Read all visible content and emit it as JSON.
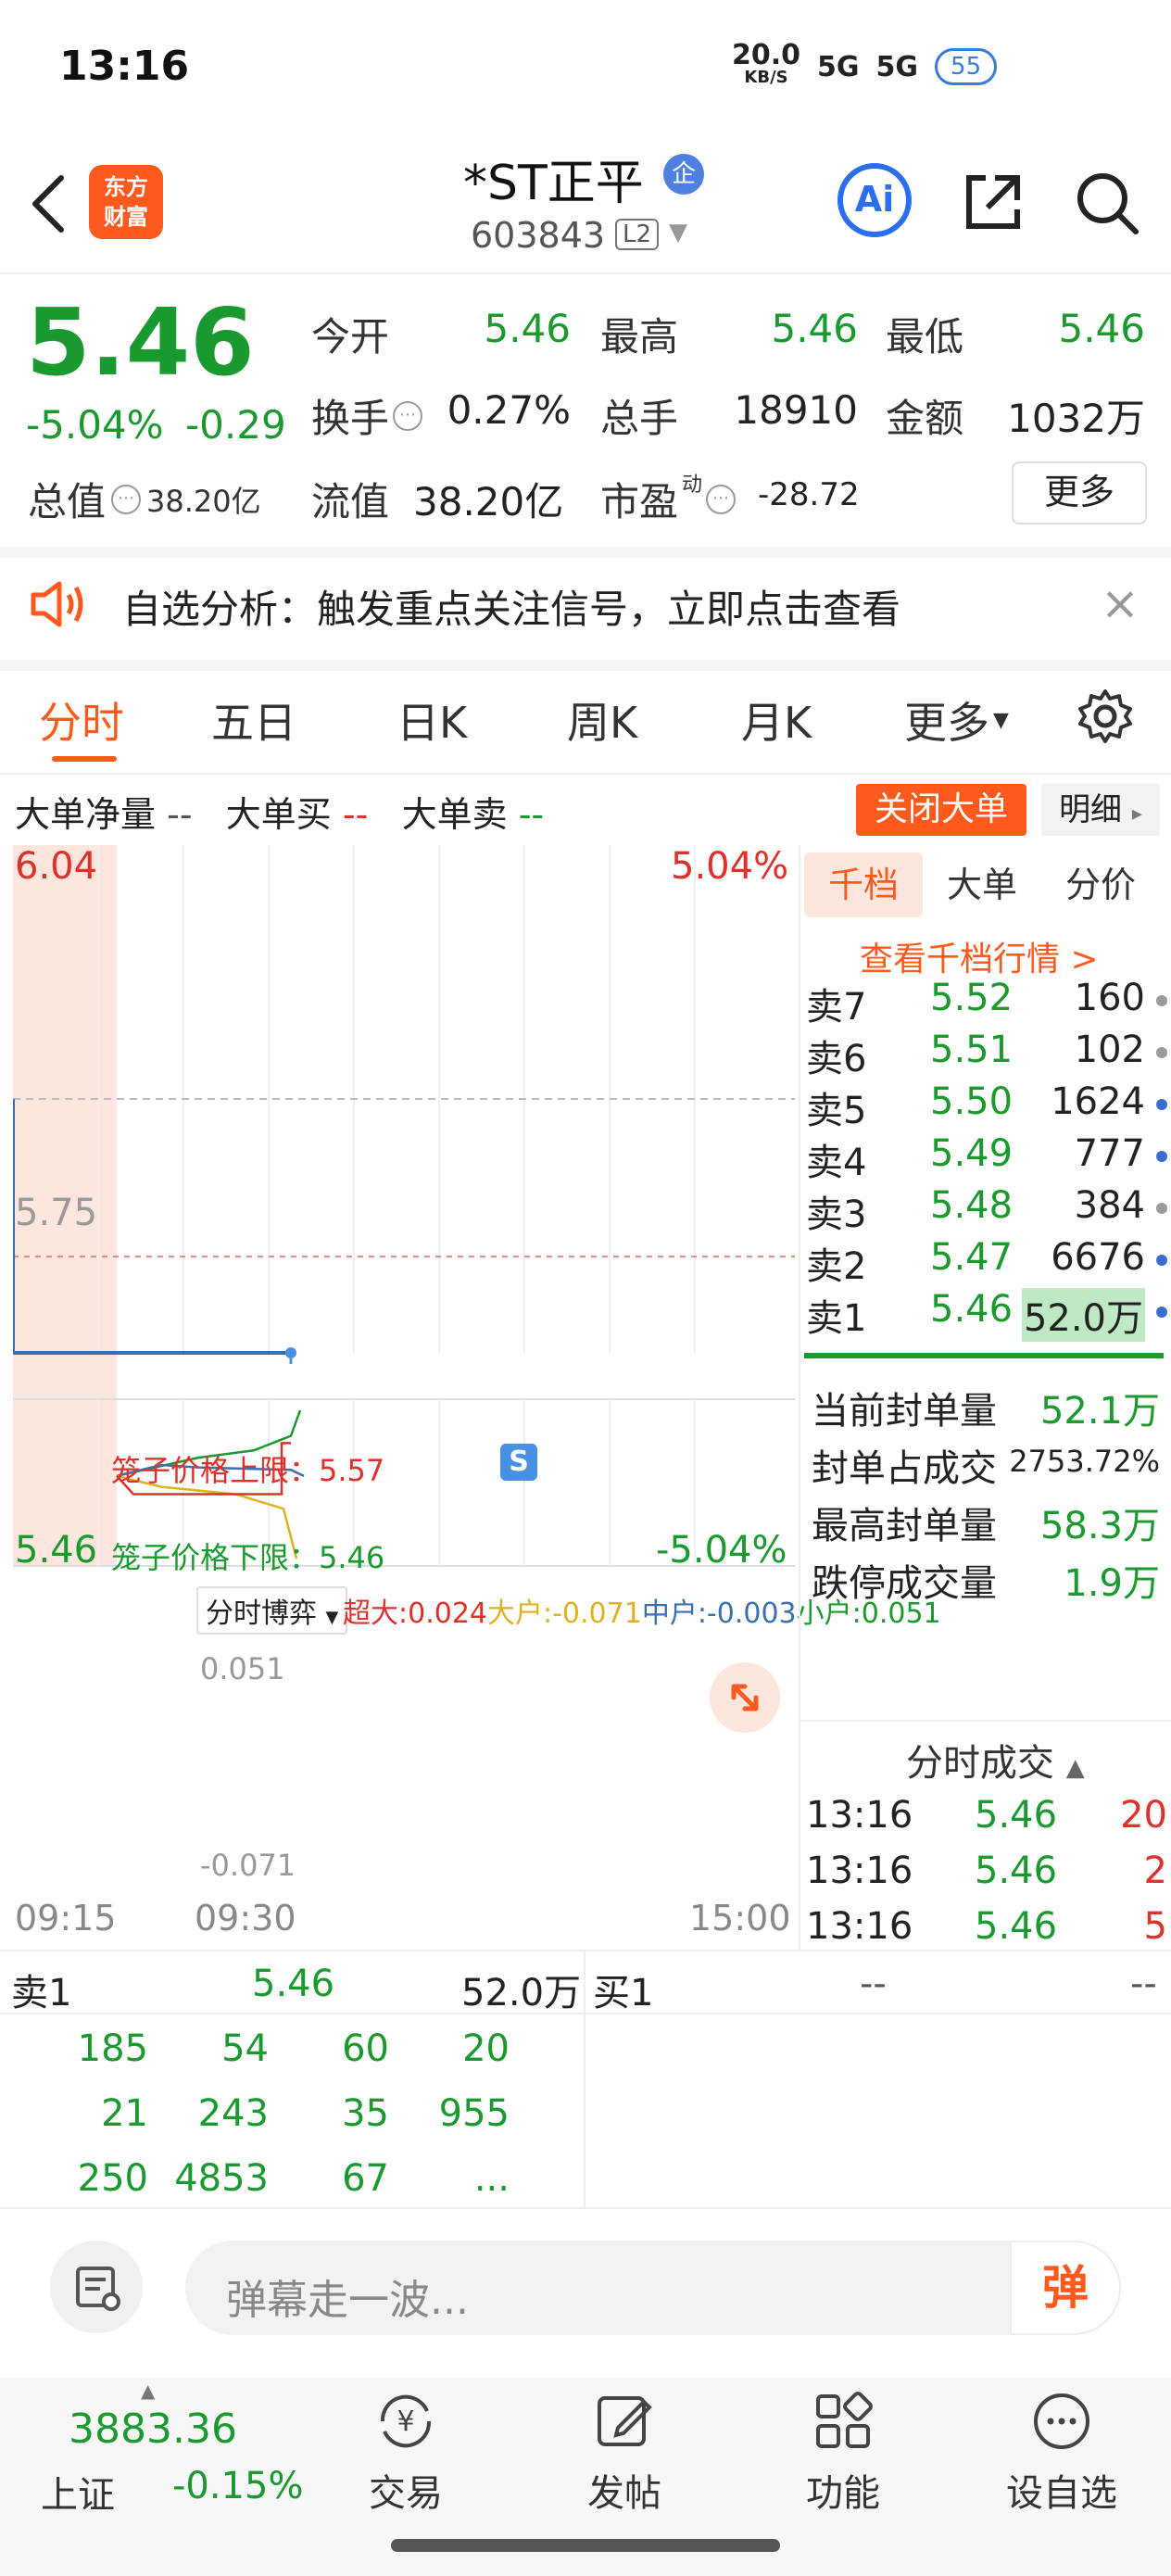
{
  "status_bar": {
    "time": "13:16",
    "net_speed": "20.0",
    "net_unit": "KB/S",
    "signal1": "5G",
    "signal2": "5G",
    "battery": "55"
  },
  "header": {
    "logo_line1": "东方",
    "logo_line2": "财富",
    "stock_name": "*ST正平",
    "badge": "企",
    "stock_code": "603843",
    "level_tag": "L2",
    "ai_label": "Ai"
  },
  "quote": {
    "price": "5.46",
    "change_pct": "-5.04%",
    "change_val": "-0.29",
    "total_value_label": "总值",
    "total_value": "38.20亿",
    "fields": [
      {
        "label": "今开",
        "value": "5.46"
      },
      {
        "label": "最高",
        "value": "5.46"
      },
      {
        "label": "最低",
        "value": "5.46"
      },
      {
        "label": "换手",
        "value": "0.27%"
      },
      {
        "label": "总手",
        "value": "18910"
      },
      {
        "label": "金额",
        "value": "1032万"
      },
      {
        "label": "流值",
        "value": "38.20亿"
      },
      {
        "label": "市盈",
        "value": "-28.72"
      }
    ],
    "pe_superscript": "动",
    "more_label": "更多"
  },
  "notice": {
    "text": "自选分析：触发重点关注信号，立即点击查看",
    "close": "×"
  },
  "tabs": [
    "分时",
    "五日",
    "日K",
    "周K",
    "月K",
    "更多"
  ],
  "big_order": {
    "net_label": "大单净量",
    "net_value": "--",
    "buy_label": "大单买",
    "buy_value": "--",
    "sell_label": "大单卖",
    "sell_value": "--",
    "close_btn": "关闭大单",
    "detail_btn": "明细"
  },
  "chart": {
    "top_price": "6.04",
    "top_pct": "5.04%",
    "mid_price": "5.75",
    "bottom_price": "5.46",
    "bottom_pct": "-5.04%",
    "upper_limit_label": "笼子价格上限：5.57",
    "lower_limit_label": "笼子价格下限：5.46",
    "s_marker": "S",
    "indicator_btn": "分时博弈",
    "legend_super": "超大:0.024",
    "legend_large": "大户:-0.071",
    "legend_mid": "中户:-0.003",
    "legend_small": "小户:0.051",
    "sub_top": "0.051",
    "sub_bottom": "-0.071",
    "time_start": "09:15",
    "time_open": "09:30",
    "time_end": "15:00"
  },
  "chart_data": {
    "type": "line",
    "title": "",
    "xlabel": "",
    "ylabel": "",
    "x": [
      "09:15",
      "09:30",
      "13:16"
    ],
    "ylim": [
      5.46,
      6.04
    ],
    "series": [
      {
        "values": [
          5.46,
          5.46,
          5.46
        ]
      }
    ],
    "sub_series": [
      {
        "name": "超大",
        "last": 0.024,
        "color": "#e0302a"
      },
      {
        "name": "大户",
        "last": -0.071,
        "color": "#e0b020"
      },
      {
        "name": "中户",
        "last": -0.003,
        "color": "#3a6fb0"
      },
      {
        "name": "小户",
        "last": 0.051,
        "color": "#1a9a2e"
      }
    ],
    "sub_ylim": [
      -0.071,
      0.051
    ]
  },
  "right_panel": {
    "tabs": [
      "千档",
      "大单",
      "分价"
    ],
    "view_link": "查看千档行情 >",
    "asks": [
      {
        "label": "卖7",
        "price": "5.52",
        "vol": "160",
        "dot": "#999"
      },
      {
        "label": "卖6",
        "price": "5.51",
        "vol": "102",
        "dot": "#999"
      },
      {
        "label": "卖5",
        "price": "5.50",
        "vol": "1624",
        "dot": "#3a6fd0"
      },
      {
        "label": "卖4",
        "price": "5.49",
        "vol": "777",
        "dot": "#3a6fd0"
      },
      {
        "label": "卖3",
        "price": "5.48",
        "vol": "384",
        "dot": "#999"
      },
      {
        "label": "卖2",
        "price": "5.47",
        "vol": "6676",
        "dot": "#3a6fd0"
      },
      {
        "label": "卖1",
        "price": "5.46",
        "vol": "52.0万",
        "dot": "#3a6fd0"
      }
    ],
    "seal": [
      {
        "label": "当前封单量",
        "value": "52.1万"
      },
      {
        "label": "封单占成交",
        "value": "2753.72%"
      },
      {
        "label": "最高封单量",
        "value": "58.3万"
      },
      {
        "label": "跌停成交量",
        "value": "1.9万"
      }
    ],
    "ft_title": "分时成交",
    "ticks": [
      {
        "time": "13:16",
        "price": "5.46",
        "vol": "20"
      },
      {
        "time": "13:16",
        "price": "5.46",
        "vol": "2"
      },
      {
        "time": "13:16",
        "price": "5.46",
        "vol": "5"
      }
    ]
  },
  "book": {
    "sell1_label": "卖1",
    "sell1_price": "5.46",
    "sell1_vol": "52.0万",
    "buy1_label": "买1",
    "buy1_price": "--",
    "buy1_vol": "--",
    "queue": [
      [
        "185",
        "54",
        "60",
        "20"
      ],
      [
        "21",
        "243",
        "35",
        "955"
      ],
      [
        "250",
        "4853",
        "67",
        "..."
      ]
    ]
  },
  "danmu": {
    "placeholder": "弹幕走一波...",
    "send": "弹"
  },
  "bottom_nav": {
    "index_value": "3883.36",
    "index_name": "上证",
    "index_change": "-0.15%",
    "items": [
      "交易",
      "发帖",
      "功能",
      "设自选"
    ]
  }
}
